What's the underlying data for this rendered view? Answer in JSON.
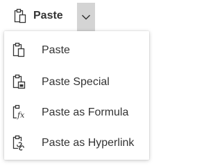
{
  "toolbar": {
    "paste_label": "Paste",
    "paste_icon": "paste-icon",
    "dropdown_icon": "chevron-down-icon"
  },
  "menu": {
    "items": [
      {
        "label": "Paste",
        "icon": "paste-icon"
      },
      {
        "label": "Paste Special",
        "icon": "paste-special-icon"
      },
      {
        "label": "Paste as Formula",
        "icon": "paste-formula-icon"
      },
      {
        "label": "Paste as Hyperlink",
        "icon": "paste-hyperlink-icon"
      }
    ]
  },
  "colors": {
    "text": "#333333",
    "toggle_background": "#d4d4d4",
    "menu_background": "#ffffff"
  }
}
